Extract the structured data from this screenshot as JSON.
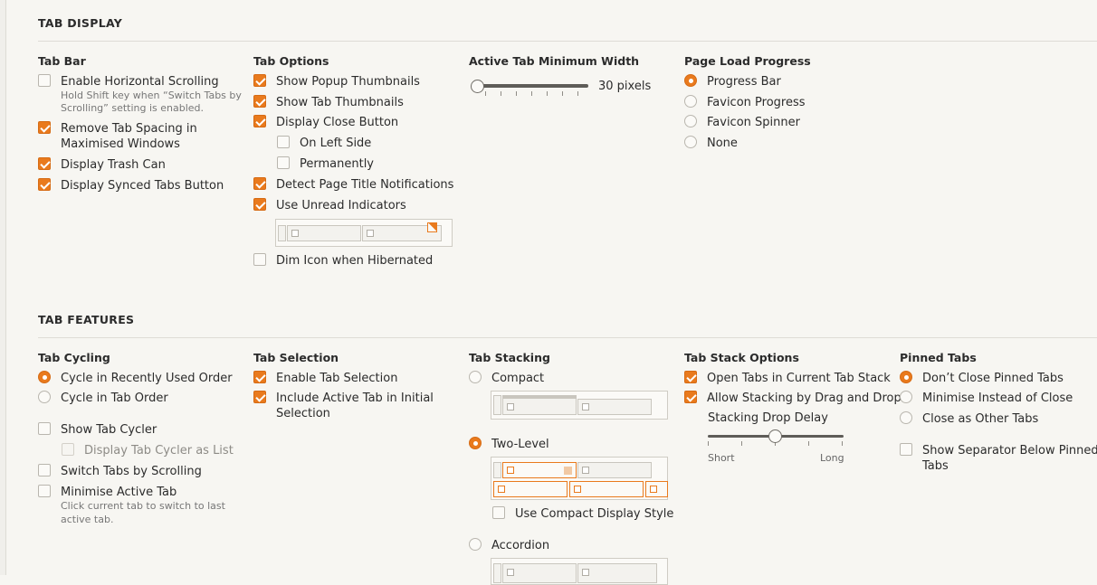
{
  "tab_display": {
    "title": "TAB DISPLAY",
    "tab_bar": {
      "title": "Tab Bar",
      "horizontal_scrolling": "Enable Horizontal Scrolling",
      "hint_line1": "Hold Shift key when “Switch Tabs by",
      "hint_line2": "Scrolling” setting is enabled.",
      "remove_spacing_line1": "Remove Tab Spacing in",
      "remove_spacing_line2": "Maximised Windows",
      "trash_can": "Display Trash Can",
      "synced_tabs": "Display Synced Tabs Button"
    },
    "tab_options": {
      "title": "Tab Options",
      "popup_thumbnails": "Show Popup Thumbnails",
      "tab_thumbnails": "Show Tab Thumbnails",
      "close_button": "Display Close Button",
      "on_left_side": "On Left Side",
      "permanently": "Permanently",
      "title_notifications": "Detect Page Title Notifications",
      "unread_indicators": "Use Unread Indicators",
      "dim_icon": "Dim Icon when Hibernated"
    },
    "active_tab_width": {
      "title": "Active Tab Minimum Width",
      "value": "30 pixels",
      "slider_fraction": 0.0
    },
    "page_load": {
      "title": "Page Load Progress",
      "options": [
        "Progress Bar",
        "Favicon Progress",
        "Favicon Spinner",
        "None"
      ],
      "selected_index": 0
    }
  },
  "tab_features": {
    "title": "TAB FEATURES",
    "cycling": {
      "title": "Tab Cycling",
      "recently_used": "Cycle in Recently Used Order",
      "tab_order": "Cycle in Tab Order",
      "show_cycler": "Show Tab Cycler",
      "cycler_list": "Display Tab Cycler as List",
      "switch_scrolling": "Switch Tabs by Scrolling",
      "minimise_active": "Minimise Active Tab",
      "hint_line1": "Click current tab to switch to last",
      "hint_line2": "active tab."
    },
    "selection": {
      "title": "Tab Selection",
      "enable": "Enable Tab Selection",
      "include_line1": "Include Active Tab in Initial",
      "include_line2": "Selection"
    },
    "stacking": {
      "title": "Tab Stacking",
      "compact": "Compact",
      "two_level": "Two-Level",
      "compact_display": "Use Compact Display Style",
      "accordion": "Accordion"
    },
    "stack_options": {
      "title": "Tab Stack Options",
      "open_current": "Open Tabs in Current Tab Stack",
      "drag_drop": "Allow Stacking by Drag and Drop",
      "delay_label": "Stacking Drop Delay",
      "short": "Short",
      "long": "Long",
      "slider_fraction": 0.5
    },
    "pinned": {
      "title": "Pinned Tabs",
      "dont_close": "Don’t Close Pinned Tabs",
      "minimise": "Minimise Instead of Close",
      "close_as_other": "Close as Other Tabs",
      "separator_line1": "Show Separator Below Pinned",
      "separator_line2": "Tabs"
    }
  },
  "colors": {
    "accent": "#e97a1d",
    "background": "#f7f6f2"
  }
}
